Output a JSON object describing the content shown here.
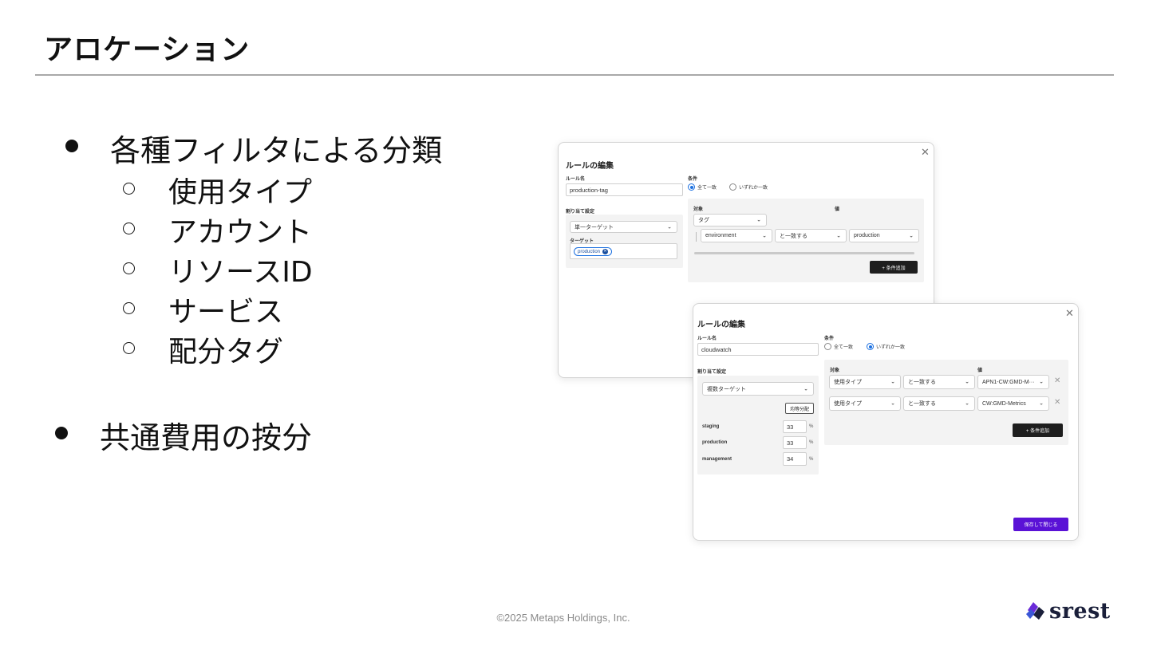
{
  "slide": {
    "title": "アロケーション",
    "bullets": [
      {
        "text": "各種フィルタによる分類",
        "sub": [
          "使用タイプ",
          "アカウント",
          "リソースID",
          "サービス",
          "配分タグ"
        ]
      },
      {
        "text": "共通費用の按分",
        "sub": []
      }
    ],
    "footer": "©2025 Metaps Holdings, Inc.",
    "logo_text": "srest"
  },
  "dialog1": {
    "title": "ルールの編集",
    "rule_name_label": "ルール名",
    "rule_name_value": "production-tag",
    "allocation_label": "割り当て設定",
    "target_mode": "単一ターゲット",
    "target_label": "ターゲット",
    "target_chip": "production",
    "conditions_label": "条件",
    "match_all": "全て一致",
    "match_any": "いずれか一致",
    "selected_match": "all",
    "col_target": "対象",
    "col_value": "値",
    "target_type": "タグ",
    "tag_key": "environment",
    "operator": "と一致する",
    "tag_value": "production",
    "add_condition": "+ 条件追加"
  },
  "dialog2": {
    "title": "ルールの編集",
    "rule_name_label": "ルール名",
    "rule_name_value": "cloudwatch",
    "allocation_label": "割り当て設定",
    "target_mode": "複数ターゲット",
    "equal_split": "均等分配",
    "targets": [
      {
        "name": "staging",
        "percent": "33"
      },
      {
        "name": "production",
        "percent": "33"
      },
      {
        "name": "management",
        "percent": "34"
      }
    ],
    "percent_unit": "%",
    "conditions_label": "条件",
    "match_all": "全て一致",
    "match_any": "いずれか一致",
    "selected_match": "any",
    "col_target": "対象",
    "col_value": "値",
    "conditions": [
      {
        "target": "使用タイプ",
        "operator": "と一致する",
        "value": "APN1-CW:GMD-M···"
      },
      {
        "target": "使用タイプ",
        "operator": "と一致する",
        "value": "CW:GMD-Metrics"
      }
    ],
    "add_condition": "+ 条件追加",
    "save_close": "保存して閉じる"
  },
  "colors": {
    "accent_blue": "#1a6fe0",
    "save_purple": "#5a12d6",
    "dark_button": "#1e1e1e",
    "logo_navy": "#1a1f3a"
  },
  "icons": [
    "close-icon",
    "chevron-down-icon",
    "remove-icon",
    "chip-remove-icon",
    "srest-logo-icon"
  ]
}
